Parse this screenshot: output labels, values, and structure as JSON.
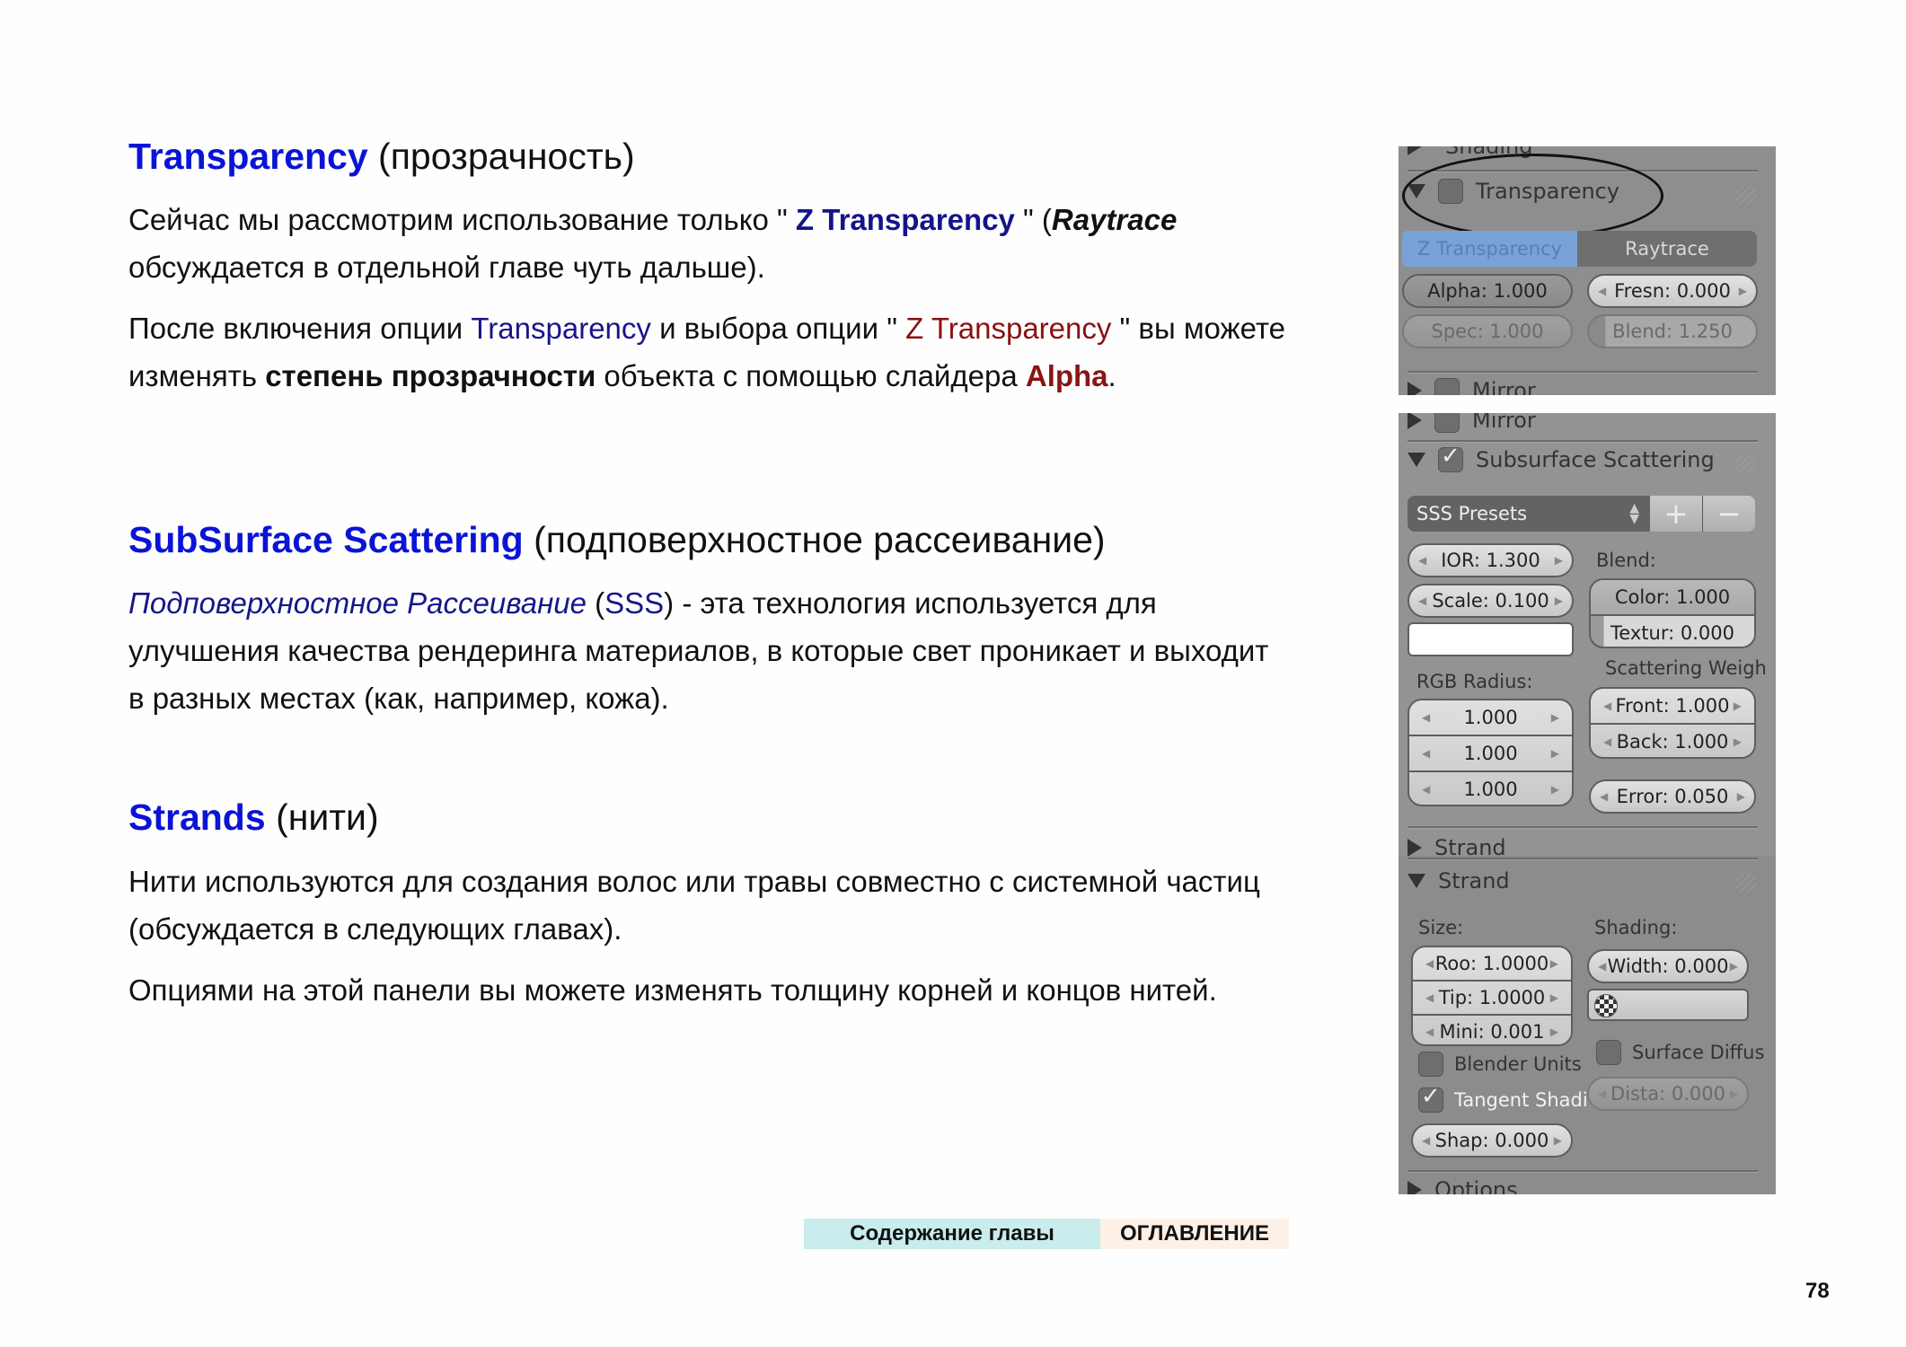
{
  "sections": {
    "transparency": {
      "title": "Transparency",
      "title_ru": "(прозрачность)",
      "p1": {
        "a": "Сейчас мы рассмотрим использование только \" ",
        "b": "Z Transparency",
        "c": " \" (",
        "d": "Raytrace",
        "e": "обсуждается в отдельной главе чуть дальше)."
      },
      "p2": {
        "a": "После включения опции ",
        "b": "Transparency",
        "c": " и выбора опции \" ",
        "d": "Z Transparency",
        "e": " \" вы можете",
        "f": "изменять ",
        "g": "степень прозрачности",
        "h": " объекта с помощью слайдера ",
        "i": "Alpha",
        "j": "."
      }
    },
    "sss": {
      "title": "SubSurface Scattering",
      "title_ru": "(подповерхностное рассеивание)",
      "p1": {
        "a": "Подповерхностное Рассеивание",
        "b": " (",
        "c": "SSS",
        "d": ") - эта технология используется для",
        "e": "улучшения качества рендеринга материалов, в которые свет проникает и выходит",
        "f": "в разных местах (как, например, кожа)."
      }
    },
    "strands": {
      "title": "Strands",
      "title_ru": "(нити)",
      "p1a": "Нити используются для создания волос или травы совместно с системной частиц",
      "p1b": "(обсуждается в следующих главах).",
      "p2": "Опциями на этой панели вы можете изменять толщину корней и концов нитей."
    }
  },
  "panels": {
    "transparency": {
      "prev_header": "Shading",
      "header": "Transparency",
      "enabled": false,
      "modes": [
        "Z Transparency",
        "Raytrace"
      ],
      "active_mode": "Z Transparency",
      "alpha": "Alpha: 1.000",
      "fresnel": "Fresn: 0.000",
      "spec": "Spec: 1.000",
      "blend": "Blend: 1.250",
      "next_header": "Mirror"
    },
    "sss": {
      "prev_header": "Mirror",
      "header": "Subsurface Scattering",
      "enabled": true,
      "presets": "SSS Presets",
      "ior": "IOR: 1.300",
      "scale": "Scale: 0.100",
      "blend_label": "Blend:",
      "color": "Color: 1.000",
      "texture": "Textur: 0.000",
      "rgb_radius_label": "RGB Radius:",
      "rgb_radius": [
        "1.000",
        "1.000",
        "1.000"
      ],
      "scattering_label": "Scattering Weigh",
      "front": "Front: 1.000",
      "back": "Back: 1.000",
      "error": "Error: 0.050",
      "next_header": "Strand"
    },
    "strand": {
      "header": "Strand",
      "size_label": "Size:",
      "root": "Roo: 1.0000",
      "tip": "Tip: 1.0000",
      "min": "Mini: 0.001",
      "blender_units": "Blender Units",
      "blender_units_checked": false,
      "tangent_shading": "Tangent Shadi",
      "tangent_shading_checked": true,
      "shape": "Shap: 0.000",
      "shading_label": "Shading:",
      "width": "Width: 0.000",
      "surface_diffuse": "Surface Diffus",
      "surface_diffuse_checked": false,
      "distance": "Dista: 0.000",
      "next_header": "Options"
    }
  },
  "footer": {
    "chapter_contents": "Содержание главы",
    "toc": "ОГЛАВЛЕНИЕ",
    "chapter_color": "#c9ecec",
    "toc_color": "#fdf0e6",
    "page_number": "78"
  }
}
